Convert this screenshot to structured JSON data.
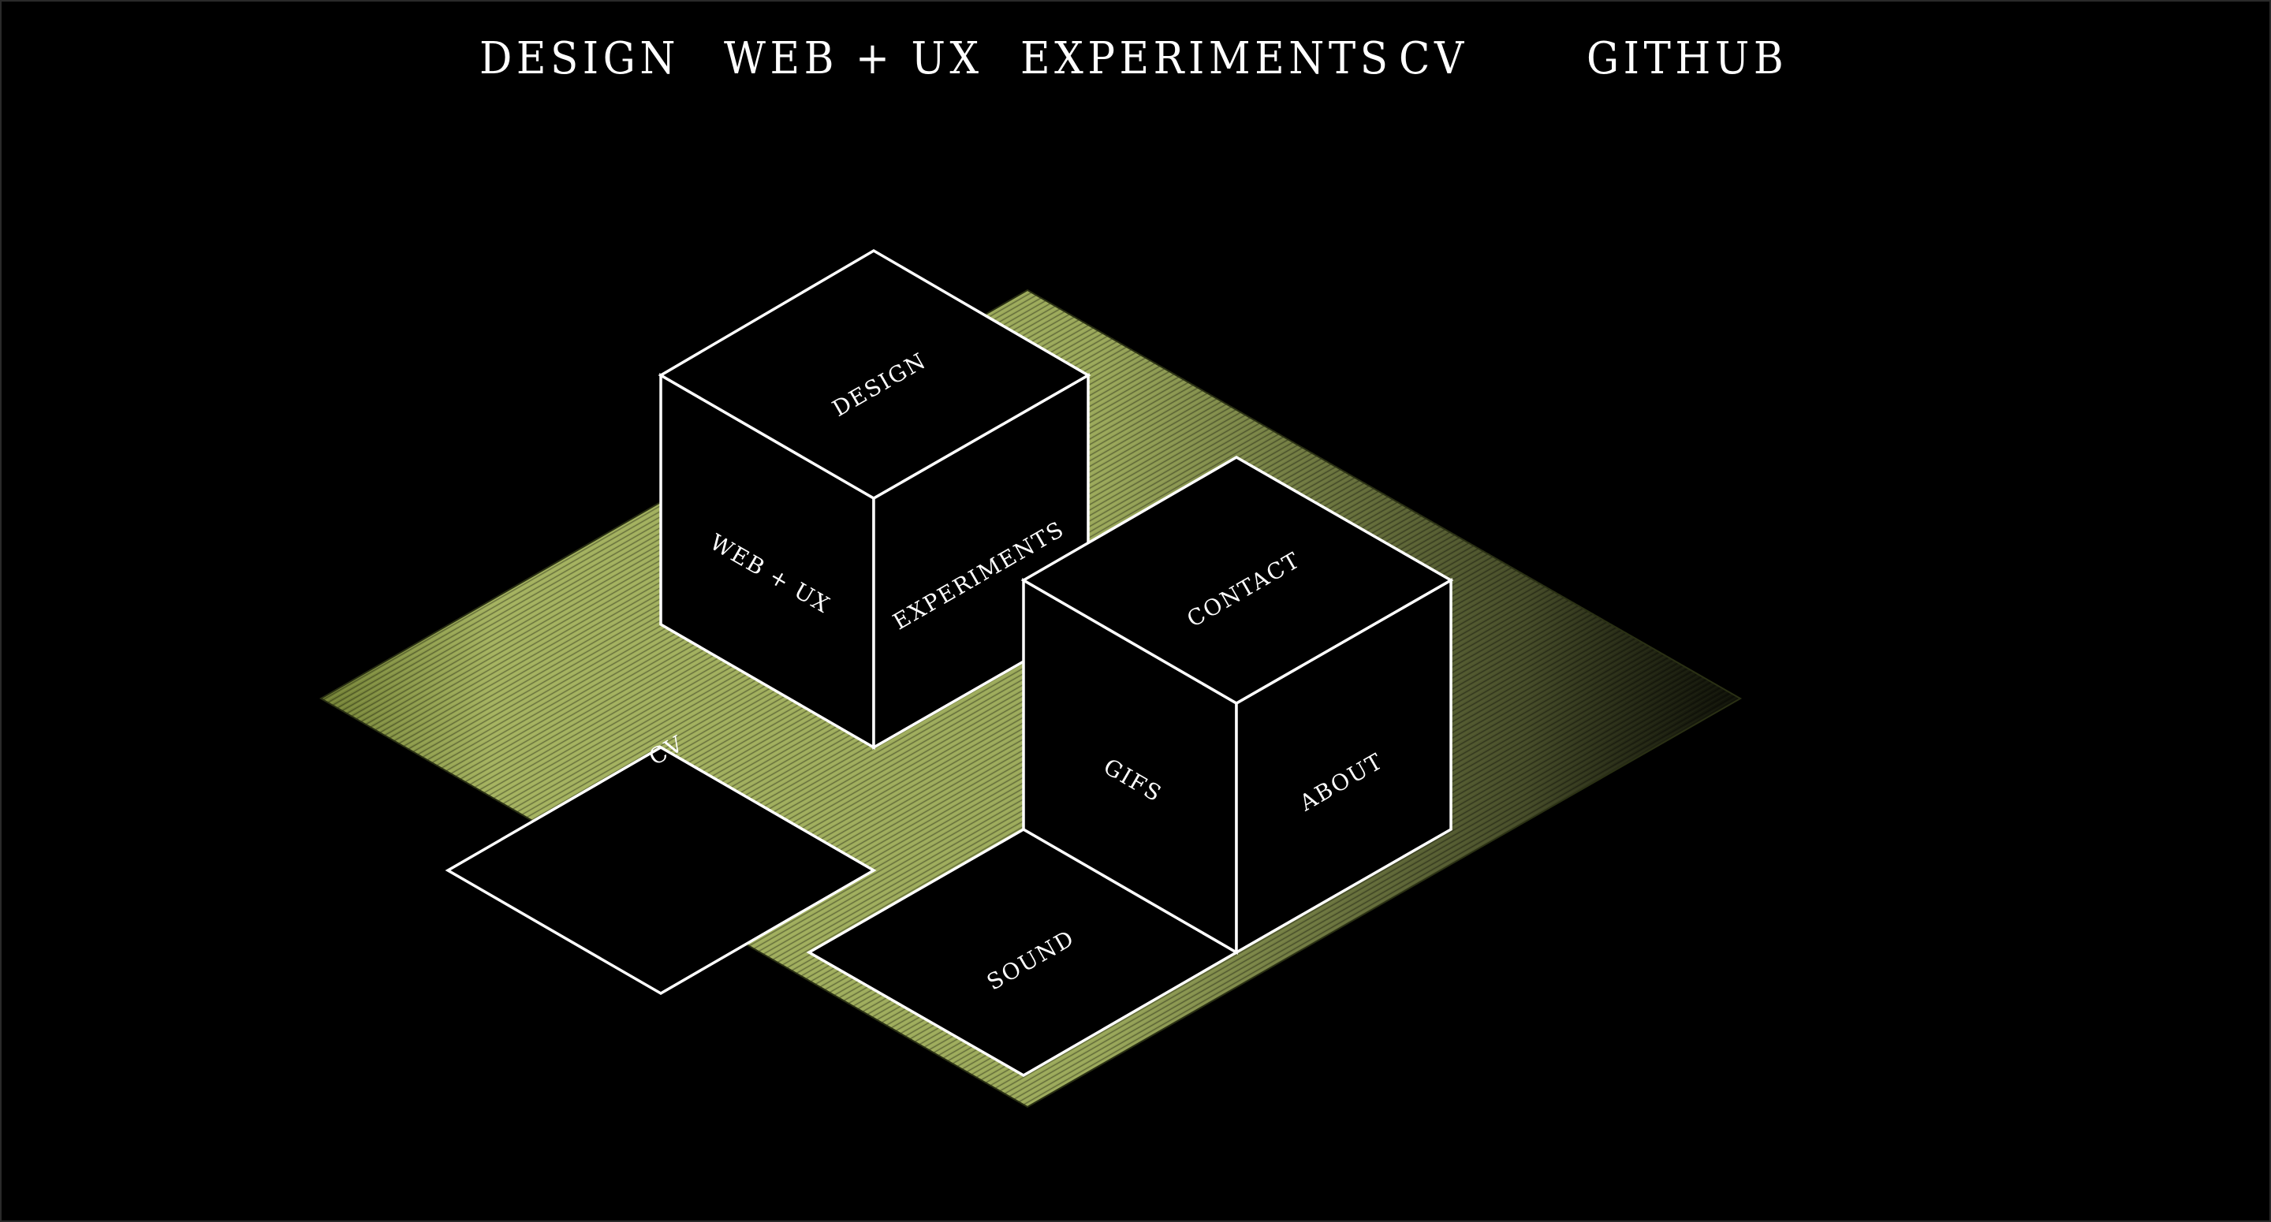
{
  "nav": {
    "items": [
      {
        "id": "design",
        "label": "DESIGN"
      },
      {
        "id": "web-ux",
        "label": "WEB + UX"
      },
      {
        "id": "experiments",
        "label": "EXPERIMENTS"
      },
      {
        "id": "cv",
        "label": "CV"
      },
      {
        "id": "github",
        "label": "GITHUB"
      }
    ]
  },
  "scene": {
    "cube_one": {
      "top_label": "DESIGN",
      "left_label": "WEB + UX",
      "right_label": "EXPERIMENTS",
      "floor_label": "CV"
    },
    "cube_two": {
      "top_label": "CONTACT",
      "left_label": "GIFS",
      "right_label": "ABOUT",
      "floor_label": "SOUND"
    }
  },
  "colors": {
    "background": "#000000",
    "platform_green": "#9aa85a",
    "platform_green_dark": "#5d6a2a",
    "outline": "#ffffff"
  }
}
